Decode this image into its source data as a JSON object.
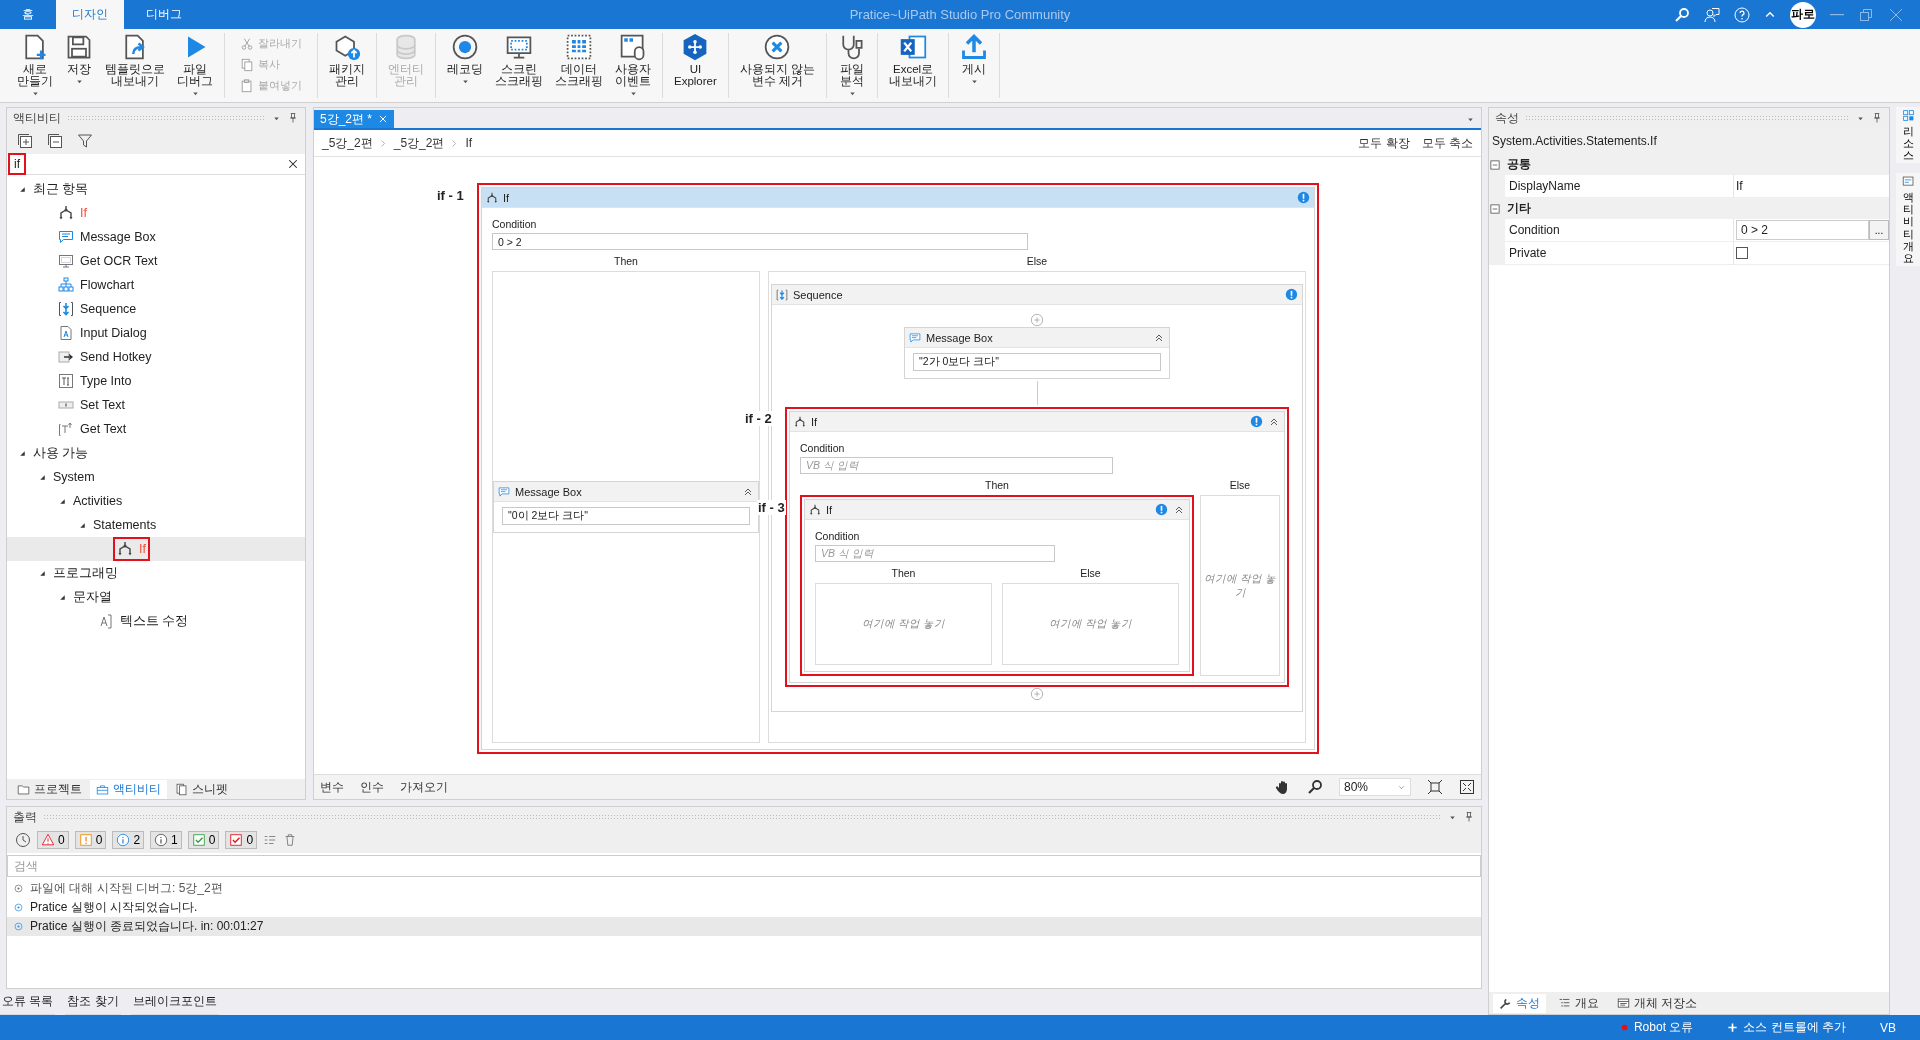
{
  "title_bar": {
    "tabs": [
      {
        "label": "홈",
        "selected": false
      },
      {
        "label": "디자인",
        "selected": true
      },
      {
        "label": "디버그",
        "selected": false
      }
    ],
    "title": "Pratice~UiPath Studio Pro Community",
    "avatar": "파로"
  },
  "ribbon": [
    {
      "items": [
        {
          "kind": "new",
          "label": "새로\n만들기",
          "dropdown": true,
          "disabled": false
        },
        {
          "kind": "save",
          "label": "저장",
          "dropdown": true,
          "disabled": false
        },
        {
          "kind": "template",
          "label": "템플릿으로\n내보내기",
          "dropdown": false,
          "disabled": false
        },
        {
          "kind": "debug",
          "label": "파일\n디버그",
          "dropdown": true,
          "disabled": false
        }
      ]
    },
    {
      "kind": "stack",
      "items": [
        {
          "kind": "cut",
          "label": "잘라내기",
          "disabled": true
        },
        {
          "kind": "copy",
          "label": "복사",
          "disabled": true
        },
        {
          "kind": "paste",
          "label": "붙여넣기",
          "disabled": true
        }
      ]
    },
    {
      "items": [
        {
          "kind": "package",
          "label": "패키지\n관리",
          "dropdown": false,
          "disabled": false
        }
      ]
    },
    {
      "items": [
        {
          "kind": "entity",
          "label": "엔터티\n관리",
          "dropdown": false,
          "disabled": true
        }
      ]
    },
    {
      "items": [
        {
          "kind": "record",
          "label": "레코딩",
          "dropdown": true,
          "disabled": false
        },
        {
          "kind": "screen",
          "label": "스크린\n스크래핑",
          "dropdown": false,
          "disabled": false
        },
        {
          "kind": "data",
          "label": "데이터\n스크래핑",
          "dropdown": false,
          "disabled": false
        },
        {
          "kind": "user_events",
          "label": "사용자\n이벤트",
          "dropdown": true,
          "disabled": false
        }
      ]
    },
    {
      "items": [
        {
          "kind": "ui_explorer",
          "label": "UI\nExplorer",
          "dropdown": false,
          "disabled": false
        }
      ]
    },
    {
      "items": [
        {
          "kind": "unused",
          "label": "사용되지 않는\n변수 제거",
          "dropdown": false,
          "disabled": false
        }
      ]
    },
    {
      "items": [
        {
          "kind": "analyze",
          "label": "파일\n분석",
          "dropdown": true,
          "disabled": false
        }
      ]
    },
    {
      "items": [
        {
          "kind": "excel",
          "label": "Excel로\n내보내기",
          "dropdown": false,
          "disabled": false
        }
      ]
    },
    {
      "items": [
        {
          "kind": "publish",
          "label": "게시",
          "dropdown": true,
          "disabled": false
        }
      ]
    }
  ],
  "activities_panel": {
    "title": "액티비티",
    "search": {
      "value": "if",
      "annotated": true
    },
    "tree": [
      {
        "label": "최근 항목",
        "expanded": true,
        "selected": false,
        "children": [
          {
            "kind": "if",
            "label": "If",
            "match": true,
            "selected": false,
            "annotated": false
          },
          {
            "kind": "message_box",
            "label": "Message Box",
            "match": false,
            "selected": false,
            "annotated": false
          },
          {
            "kind": "ocr",
            "label": "Get OCR Text",
            "match": false,
            "selected": false,
            "annotated": false
          },
          {
            "kind": "flowchart",
            "label": "Flowchart",
            "match": false,
            "selected": false,
            "annotated": false
          },
          {
            "kind": "sequence",
            "label": "Sequence",
            "match": false,
            "selected": false,
            "annotated": false
          },
          {
            "kind": "input_dialog",
            "label": "Input Dialog",
            "match": false,
            "selected": false,
            "annotated": false
          },
          {
            "kind": "hotkey",
            "label": "Send Hotkey",
            "match": false,
            "selected": false,
            "annotated": false
          },
          {
            "kind": "type_into",
            "label": "Type Into",
            "match": false,
            "selected": false,
            "annotated": false
          },
          {
            "kind": "set_text",
            "label": "Set Text",
            "match": false,
            "selected": false,
            "annotated": false
          },
          {
            "kind": "get_text",
            "label": "Get Text",
            "match": false,
            "selected": false,
            "annotated": false
          }
        ]
      },
      {
        "label": "사용 가능",
        "expanded": true,
        "selected": false,
        "children": [
          {
            "label": "System",
            "expanded": true,
            "selected": false,
            "children": [
              {
                "label": "Activities",
                "expanded": true,
                "selected": false,
                "children": [
                  {
                    "label": "Statements",
                    "expanded": true,
                    "selected": false,
                    "children": [
                      {
                        "kind": "if",
                        "label": "If",
                        "match": true,
                        "selected": true,
                        "annotated": true
                      }
                    ]
                  }
                ]
              }
            ]
          },
          {
            "label": "프로그래밍",
            "expanded": true,
            "selected": false,
            "children": [
              {
                "label": "문자열",
                "expanded": true,
                "selected": false,
                "children": [
                  {
                    "kind": "modify_text",
                    "label": "텍스트 수정",
                    "match": false,
                    "selected": false,
                    "annotated": false
                  }
                ]
              }
            ]
          }
        ]
      }
    ],
    "tabs": [
      {
        "kind": "project",
        "label": "프로젝트",
        "selected": false
      },
      {
        "kind": "activities",
        "label": "액티비티",
        "selected": true
      },
      {
        "kind": "snippets",
        "label": "스니펫",
        "selected": false
      }
    ]
  },
  "editor": {
    "tabs": [
      {
        "label": "5강_2편 *",
        "selected": true
      }
    ],
    "breadcrumb": [
      "_5강_2편",
      "_5강_2편",
      "If"
    ],
    "actions": [
      "모두 확장",
      "모두 축소"
    ],
    "root": {
      "kind": "if",
      "annotation": "if - 1",
      "title": "If",
      "selected": true,
      "validation_error": true,
      "condition_label": "Condition",
      "condition": "0 > 2",
      "then_label": "Then",
      "else_label": "Else",
      "then": {
        "kind": "message_box",
        "title": "Message Box",
        "selected": false,
        "validation_error": false,
        "text": "\"0이 2보다 크다\""
      },
      "else": {
        "kind": "sequence",
        "title": "Sequence",
        "selected": false,
        "validation_error": true,
        "children": [
          {
            "kind": "message_box",
            "title": "Message Box",
            "selected": false,
            "validation_error": false,
            "text": "\"2가 0보다 크다\""
          },
          {
            "kind": "if",
            "annotation": "if - 2",
            "title": "If",
            "selected": false,
            "validation_error": true,
            "condition_label": "Condition",
            "placeholder": "VB 식 입력",
            "then_label": "Then",
            "else_label": "Else",
            "then": {
              "kind": "if",
              "annotation": "if - 3",
              "title": "If",
              "selected": false,
              "validation_error": true,
              "condition_label": "Condition",
              "placeholder": "VB 식 입력",
              "then_label": "Then",
              "else_label": "Else",
              "then": {
                "kind": "drop_zone",
                "text": "여기에 작업 놓기"
              },
              "else": {
                "kind": "drop_zone",
                "text": "여기에 작업 놓기"
              }
            },
            "else": {
              "kind": "drop_zone",
              "text": "여기에 작업 놓기"
            }
          }
        ]
      }
    },
    "bottom_tabs": [
      "변수",
      "인수",
      "가져오기"
    ],
    "zoom": "80%"
  },
  "output": {
    "title": "출력",
    "filters": [
      {
        "kind": "error",
        "count": "0"
      },
      {
        "kind": "warning",
        "count": "0"
      },
      {
        "kind": "info",
        "count": "2"
      },
      {
        "kind": "trace",
        "count": "1"
      },
      {
        "kind": "success",
        "count": "0"
      },
      {
        "kind": "fail",
        "count": "0"
      }
    ],
    "search": {
      "placeholder": "검색"
    },
    "lines": [
      {
        "kind": "trace",
        "text": "파일에 대해 시작된 디버그: 5강_2편",
        "selected": false
      },
      {
        "kind": "info",
        "text": "Pratice 실행이 시작되었습니다.",
        "selected": false
      },
      {
        "kind": "info",
        "text": "Pratice 실행이 종료되었습니다. in: 00:01:27",
        "selected": true
      }
    ]
  },
  "bottom_tabs": [
    "오류 목록",
    "참조 찾기",
    "브레이크포인트"
  ],
  "properties": {
    "title": "속성",
    "type": "System.Activities.Statements.If",
    "categories": [
      {
        "label": "공통",
        "expanded": true,
        "rows": [
          {
            "kind": "text",
            "name": "DisplayName",
            "value": "If"
          }
        ]
      },
      {
        "label": "기타",
        "expanded": true,
        "rows": [
          {
            "kind": "expression",
            "name": "Condition",
            "value": "0 > 2",
            "button": "..."
          },
          {
            "kind": "checkbox",
            "name": "Private",
            "checked": false
          }
        ]
      }
    ],
    "tabs": [
      {
        "kind": "properties",
        "label": "속성",
        "selected": true
      },
      {
        "kind": "outline",
        "label": "개요",
        "selected": false
      },
      {
        "kind": "repository",
        "label": "개체 저장소",
        "selected": false
      }
    ]
  },
  "side_tabs": [
    {
      "kind": "resources",
      "label": "리소스"
    },
    {
      "kind": "activity_overview",
      "label": "액티비티 개요"
    }
  ],
  "status_bar": [
    {
      "kind": "robot",
      "label": "Robot 오류"
    },
    {
      "kind": "source",
      "label": "소스 컨트롤에 추가"
    },
    {
      "kind": "language",
      "label": "VB"
    }
  ]
}
